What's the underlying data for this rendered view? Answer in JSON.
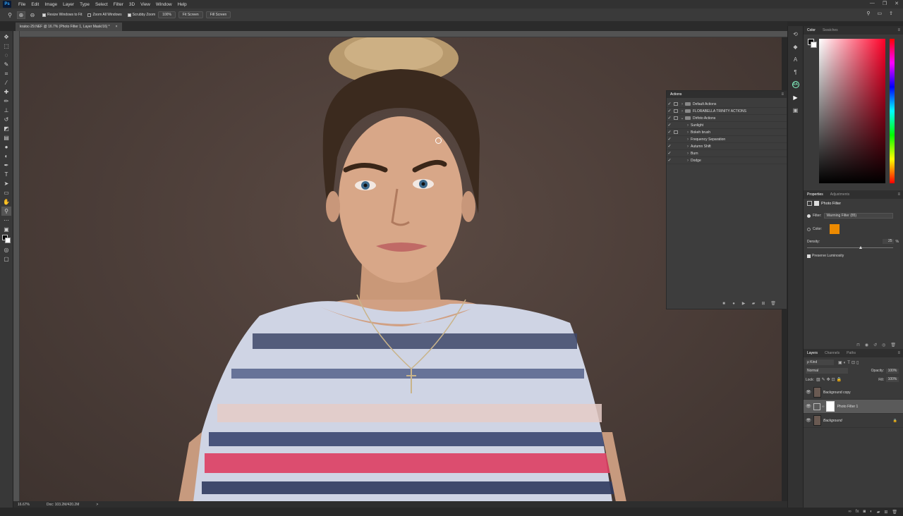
{
  "app": {
    "logo": "Ps"
  },
  "menu": [
    "File",
    "Edit",
    "Image",
    "Layer",
    "Type",
    "Select",
    "Filter",
    "3D",
    "View",
    "Window",
    "Help"
  ],
  "window_controls": [
    "—",
    "❐",
    "✕"
  ],
  "options": {
    "resize_windows_label": "Resize Windows to Fit",
    "zoom_all_label": "Zoom All Windows",
    "scrubby_zoom_label": "Scrubby Zoom",
    "zoom_pct": "100%",
    "fit_screen": "Fit Screen",
    "fill_screen": "Fill Screen"
  },
  "document_tab": {
    "title": "kratoc-29.NEF @ 16.7% (Photo Filter 1, Layer Mask/16) *",
    "close": "×"
  },
  "status": {
    "zoom": "16.67%",
    "doc": "Doc: 103.2M/420.2M",
    "arrow": ">"
  },
  "actions_panel": {
    "title": "Actions",
    "rows": [
      {
        "name": "Default Actions",
        "type": "set",
        "open": false
      },
      {
        "name": "FLORABELLA TRINITY ACTIONS",
        "type": "set",
        "open": false
      },
      {
        "name": "Dirfoto Actions",
        "type": "set",
        "open": true
      },
      {
        "name": "Sunlight",
        "type": "action"
      },
      {
        "name": "Bokeh brush",
        "type": "action"
      },
      {
        "name": "Frequency Separation",
        "type": "action"
      },
      {
        "name": "Autumn Shift",
        "type": "action"
      },
      {
        "name": "Burn",
        "type": "action"
      },
      {
        "name": "Dodge",
        "type": "action"
      }
    ],
    "footer_icons": [
      "stop-icon",
      "record-icon",
      "play-icon",
      "folder-icon",
      "new-action-icon",
      "trash-icon"
    ]
  },
  "color_panel": {
    "tabs": [
      "Color",
      "Swatches"
    ],
    "fg": "#000000",
    "bg": "#ffffff",
    "hue": "#ff0028"
  },
  "properties_panel": {
    "tabs": [
      "Properties",
      "Adjustments"
    ],
    "title": "Photo Filter",
    "filter_label": "Filter:",
    "filter_value": "Warming Filter (85)",
    "color_label": "Color:",
    "color_swatch": "#ec8a00",
    "density_label": "Density:",
    "density_value": "25",
    "density_unit": "%",
    "preserve_label": "Preserve Luminosity"
  },
  "layers_panel": {
    "tabs": [
      "Layers",
      "Channels",
      "Paths"
    ],
    "kind_label": "ρ Kind",
    "blend_mode": "Normal",
    "opacity_label": "Opacity:",
    "opacity": "100%",
    "lock_label": "Lock:",
    "fill_label": "Fill:",
    "fill": "100%",
    "layers": [
      {
        "name": "Background copy",
        "selected": false
      },
      {
        "name": "Photo Filter 1",
        "selected": true
      },
      {
        "name": "Background",
        "selected": false
      }
    ]
  }
}
